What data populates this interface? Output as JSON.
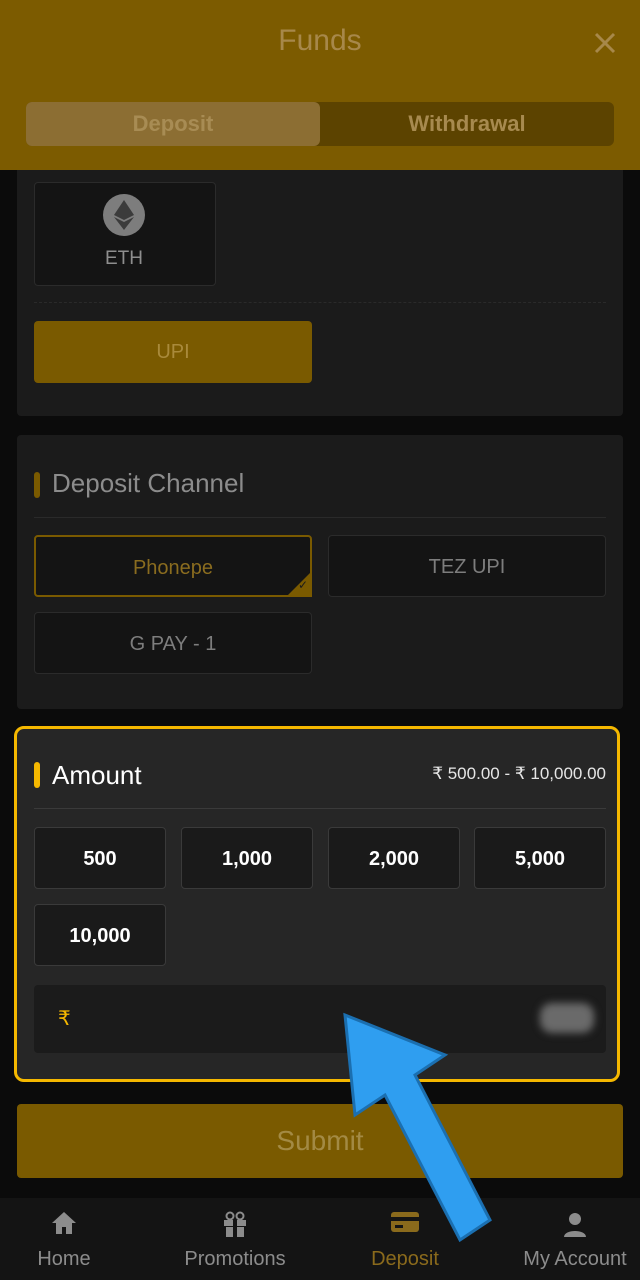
{
  "header": {
    "title": "Funds",
    "close_icon": "close-icon"
  },
  "tabs": [
    {
      "label": "Deposit",
      "active": true
    },
    {
      "label": "Withdrawal",
      "active": false
    }
  ],
  "crypto": {
    "eth_label": "ETH",
    "upi_label": "UPI"
  },
  "channel": {
    "title": "Deposit Channel",
    "options": [
      {
        "label": "Phonepe",
        "selected": true
      },
      {
        "label": "TEZ UPI"
      },
      {
        "label": "G PAY - 1"
      }
    ]
  },
  "amount": {
    "title": "Amount",
    "range": "₹ 500.00 - ₹ 10,000.00",
    "presets": [
      "500",
      "1,000",
      "2,000",
      "5,000",
      "10,000"
    ],
    "currency_symbol": "₹",
    "input_value": ""
  },
  "submit_label": "Submit",
  "nav": [
    {
      "label": "Home",
      "icon": "home-icon"
    },
    {
      "label": "Promotions",
      "icon": "gift-icon"
    },
    {
      "label": "Deposit",
      "icon": "card-icon",
      "active": true
    },
    {
      "label": "My Account",
      "icon": "user-icon"
    }
  ],
  "colors": {
    "accent": "#f5b800",
    "overlay_header": "#7c5b00",
    "arrow": "#2f9ef0"
  }
}
